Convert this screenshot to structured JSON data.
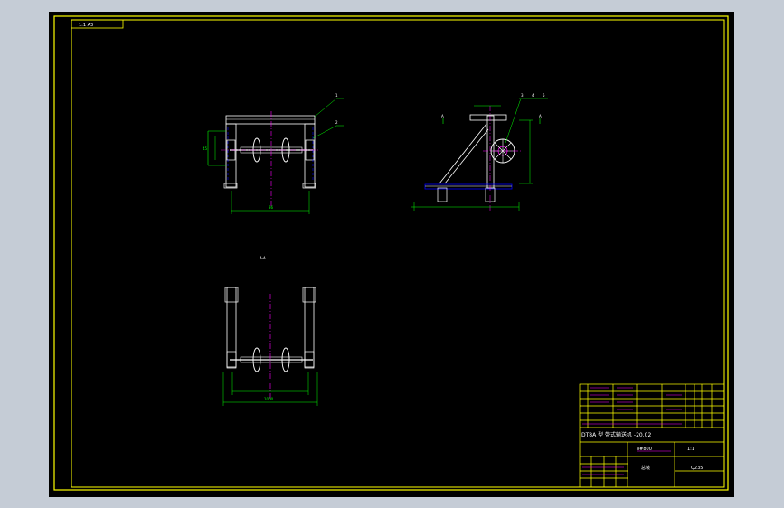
{
  "drawing": {
    "sheet_tag": "1:1 A3",
    "view_label": "A-A",
    "dimensions": {
      "front_width": "36",
      "front_height": "45",
      "plan_width": "1000"
    },
    "side_callouts": [
      "3",
      "4",
      "5"
    ],
    "front_callouts": [
      "1",
      "2"
    ]
  },
  "title_block": {
    "title": "DT8A 型 带式输送机 -20.02",
    "drawing_no": "8#800",
    "scale": "1:1",
    "name": "总装",
    "material": "Q235"
  },
  "colors": {
    "background": "#000000",
    "frame": "#ffff00",
    "geometry": "#ffffff",
    "dimension": "#00ff00",
    "centerline": "#ff00ff",
    "hidden": "#0000ff"
  }
}
